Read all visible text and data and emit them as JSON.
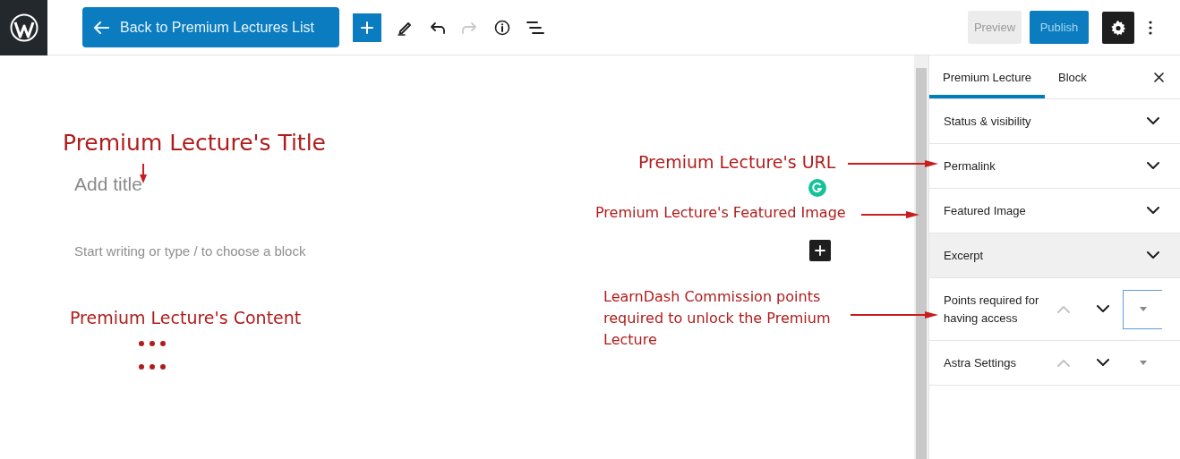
{
  "top_bar": {
    "back_button": {
      "label": "Back to Premium Lectures List"
    },
    "toolbar": [
      {
        "kind": "add",
        "disabled": false
      },
      {
        "kind": "edit",
        "disabled": false
      },
      {
        "kind": "undo",
        "disabled": false
      },
      {
        "kind": "redo",
        "disabled": true
      },
      {
        "kind": "info",
        "disabled": false
      },
      {
        "kind": "outline",
        "disabled": false
      }
    ],
    "preview_button": {
      "label": "Preview"
    },
    "publish_button": {
      "label": "Publish"
    }
  },
  "editor": {
    "title_placeholder": "Add title",
    "block_placeholder": "Start writing or type / to choose a block"
  },
  "sidebar": {
    "tabs": [
      {
        "label": "Premium Lecture",
        "selected": true
      },
      {
        "label": "Block",
        "selected": false
      }
    ],
    "panels": [
      {
        "kind": "simple",
        "title": "Status & visibility",
        "highlighted": false
      },
      {
        "kind": "simple",
        "title": "Permalink",
        "highlighted": false
      },
      {
        "kind": "simple",
        "title": "Featured Image",
        "highlighted": false
      },
      {
        "kind": "simple",
        "title": "Excerpt",
        "highlighted": true
      },
      {
        "kind": "movable",
        "title": "Points required for having access",
        "highlighted": false,
        "menu_boxed": true
      },
      {
        "kind": "movable",
        "title": "Astra Settings",
        "highlighted": false,
        "menu_boxed": false
      }
    ]
  },
  "annotations": [
    {
      "kind": "title",
      "text": "Premium Lecture's Title"
    },
    {
      "kind": "url",
      "text": "Premium Lecture's URL"
    },
    {
      "kind": "featured",
      "text": "Premium Lecture's Featured Image"
    },
    {
      "kind": "content",
      "text": "Premium Lecture's Content"
    },
    {
      "kind": "points",
      "text": "LearnDash Commission points required to unlock the Premium Lecture"
    }
  ]
}
